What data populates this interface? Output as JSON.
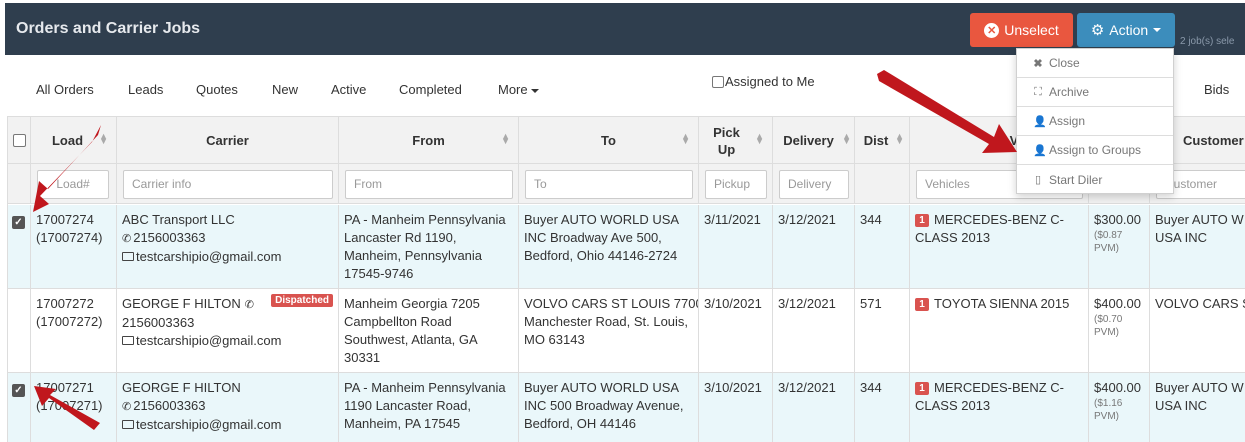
{
  "app": {
    "title": "Orders and Carrier Jobs"
  },
  "toolbar": {
    "unselect_label": "Unselect",
    "action_label": "Action",
    "selected_count": "2 job(s) sele"
  },
  "action_menu": [
    {
      "label": "Close",
      "icon": "x-icon"
    },
    {
      "label": "Archive",
      "icon": "archive-icon"
    },
    {
      "label": "Assign",
      "icon": "user-plus-icon"
    },
    {
      "label": "Assign to Groups",
      "icon": "users-plus-icon"
    },
    {
      "label": "Start Diler",
      "icon": "mobile-icon"
    }
  ],
  "tabs": [
    "All Orders",
    "Leads",
    "Quotes",
    "New",
    "Active",
    "Completed",
    "More",
    "Bids"
  ],
  "assigned_to_me": "Assigned to Me",
  "columns": {
    "load": "Load",
    "carrier": "Carrier",
    "from": "From",
    "to": "To",
    "pickup_1": "Pick",
    "pickup_2": "Up",
    "delivery": "Delivery",
    "dist": "Dist",
    "vehicles": "V",
    "customer": "Customer"
  },
  "filters": {
    "load": "Load#",
    "carrier": "Carrier info",
    "from": "From",
    "to": "To",
    "pickup": "Pickup",
    "delivery": "Delivery",
    "vehicles": "Vehicles",
    "customer": "Customer"
  },
  "rows": [
    {
      "selected": true,
      "load": [
        "17007274",
        "(17007274)"
      ],
      "carrier_name": "ABC Transport LLC",
      "carrier_phone": "2156003363",
      "carrier_email": "testcarshipio@gmail.com",
      "dispatched": "",
      "from": [
        "PA - Manheim Pennsylvania",
        "Lancaster Rd 1190,",
        "Manheim, Pennsylvania",
        "17545-9746"
      ],
      "to": [
        "Buyer AUTO WORLD USA",
        "INC Broadway Ave 500,",
        "Bedford, Ohio 44146-2724"
      ],
      "pickup": "3/11/2021",
      "delivery": "3/12/2021",
      "dist": "344",
      "vehicle_qty": "1",
      "vehicle": [
        "MERCEDES-BENZ C-",
        "CLASS 2013"
      ],
      "price": "$300.00",
      "pvm": [
        "($0.87",
        "PVM)"
      ],
      "customer": [
        "Buyer AUTO W",
        "USA INC"
      ]
    },
    {
      "selected": false,
      "load": [
        "17007272",
        "(17007272)"
      ],
      "carrier_name": "GEORGE F HILTON",
      "carrier_phone": "2156003363",
      "carrier_email": "testcarshipio@gmail.com",
      "dispatched": "Dispatched",
      "from": [
        "Manheim Georgia 7205",
        "Campbellton Road",
        "Southwest, Atlanta, GA",
        "30331"
      ],
      "to": [
        "VOLVO CARS ST LOUIS 7700",
        "Manchester Road, St. Louis,",
        "MO 63143"
      ],
      "pickup": "3/10/2021",
      "delivery": "3/12/2021",
      "dist": "571",
      "vehicle_qty": "1",
      "vehicle": [
        "TOYOTA SIENNA 2015"
      ],
      "price": "$400.00",
      "pvm": [
        "($0.70",
        "PVM)"
      ],
      "customer": [
        "VOLVO CARS ST"
      ]
    },
    {
      "selected": true,
      "load": [
        "17007271",
        "(17007271)"
      ],
      "carrier_name": "GEORGE F HILTON",
      "carrier_phone": "2156003363",
      "carrier_email": "testcarshipio@gmail.com",
      "dispatched": "",
      "from": [
        "PA - Manheim Pennsylvania",
        "1190 Lancaster Road,",
        "Manheim, PA 17545"
      ],
      "to": [
        "Buyer AUTO WORLD USA",
        "INC 500 Broadway Avenue,",
        "Bedford, OH 44146"
      ],
      "pickup": "3/10/2021",
      "delivery": "3/12/2021",
      "dist": "344",
      "vehicle_qty": "1",
      "vehicle": [
        "MERCEDES-BENZ C-",
        "CLASS 2013"
      ],
      "price": "$400.00",
      "pvm": [
        "($1.16",
        "PVM)"
      ],
      "customer": [
        "Buyer AUTO W",
        "USA INC"
      ]
    }
  ],
  "colors": {
    "topbar": "#2f3e4e",
    "unselect": "#e9573f",
    "action": "#3c8dbc",
    "selected_row": "#eaf7fa",
    "annotation_arrow": "#c0171d"
  }
}
